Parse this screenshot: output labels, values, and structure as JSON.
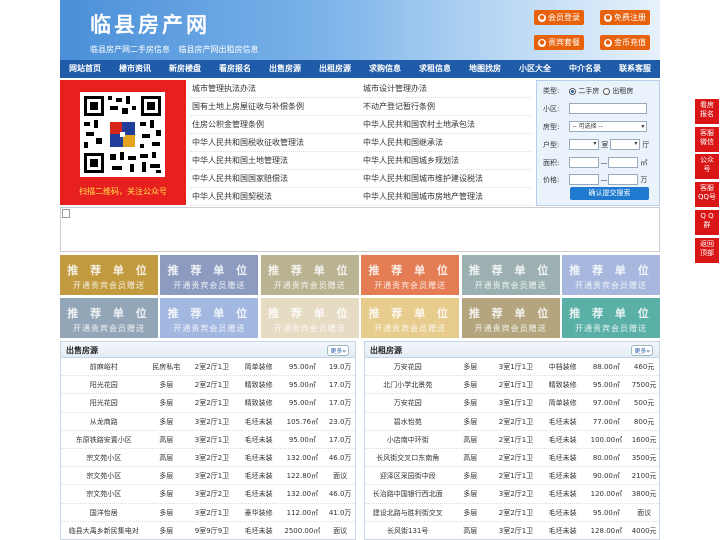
{
  "header": {
    "title": "临县房产网",
    "subtitle": "临县房产网二手房信息  临县房产网出租房信息",
    "buttons": [
      "会员登录",
      "免费注册",
      "贵宾套餐",
      "金币充值"
    ]
  },
  "nav": [
    "网站首页",
    "楼市资讯",
    "新房楼盘",
    "看房报名",
    "出售房源",
    "出租房源",
    "求购信息",
    "求租信息",
    "地图找房",
    "小区大全",
    "中介名录",
    "联系客服"
  ],
  "qr_caption": "扫描二维码，关注公众号",
  "links": [
    [
      "城市管理执法办法",
      "城市设计管理办法"
    ],
    [
      "国有土地上房屋征收与补偿条例",
      "不动产登记暂行条例"
    ],
    [
      "住房公积金管理条例",
      "中华人民共和国农村土地承包法"
    ],
    [
      "中华人民共和国税收征收管理法",
      "中华人民共和国继承法"
    ],
    [
      "中华人民共和国土地管理法",
      "中华人民共和国城乡规划法"
    ],
    [
      "中华人民共和国国家赔偿法",
      "中华人民共和国城市维护建设税法"
    ],
    [
      "中华人民共和国契税法",
      "中华人民共和国城市房地产管理法"
    ]
  ],
  "search": {
    "type_label": "类型:",
    "type_opt1": "二手房",
    "type_opt2": "出租房",
    "community_label": "小区:",
    "housetype_label": "房型:",
    "housetype_value": "-- 可选择 --",
    "layout_label": "户型:",
    "room": "室",
    "hall": "厅",
    "area_label": "面积:",
    "area_unit": "㎡",
    "price_label": "价格:",
    "price_unit": "万",
    "range_sep": "—",
    "submit": "确认提交搜索"
  },
  "tile": {
    "line1": "推 荐 单 位",
    "line2": "开通贵宾会员赠送"
  },
  "tile_colors": [
    "#c29a3f",
    "#8d9bc1",
    "#b9b391",
    "#e57d54",
    "#9cb0b2",
    "#a7b7dd",
    "#93a6b8",
    "#a3b8e0",
    "#e6dcc3",
    "#e7cc8d",
    "#b4a57f",
    "#5ab0a7"
  ],
  "sale": {
    "title": "出售房源",
    "more": "更多»",
    "rows": [
      [
        "前麻峪村",
        "民房私宅",
        "2室2厅1卫",
        "简单装修",
        "95.00㎡",
        "19.0万"
      ],
      [
        "阳光花园",
        "多层",
        "2室2厅1卫",
        "精致装修",
        "95.00㎡",
        "17.0万"
      ],
      [
        "阳光花园",
        "多层",
        "2室2厅1卫",
        "精致装修",
        "95.00㎡",
        "17.0万"
      ],
      [
        "从龙商路",
        "多层",
        "3室2厅1卫",
        "毛坯未装",
        "105.76㎡",
        "23.0万"
      ],
      [
        "东原铁路安置小区",
        "高层",
        "3室2厅1卫",
        "毛坯未装",
        "95.00㎡",
        "17.0万"
      ],
      [
        "宗文苑小区",
        "高层",
        "3室2厅2卫",
        "毛坯未装",
        "132.00㎡",
        "46.0万"
      ],
      [
        "宗文苑小区",
        "多层",
        "3室2厅1卫",
        "毛坯未装",
        "122.80㎡",
        "面议"
      ],
      [
        "宗文苑小区",
        "多层",
        "3室2厅2卫",
        "毛坯未装",
        "132.00㎡",
        "46.0万"
      ],
      [
        "国洋怡居",
        "多层",
        "3室2厅1卫",
        "豪华装修",
        "112.00㎡",
        "41.0万"
      ],
      [
        "临县大禹乡新民集电对",
        "多层",
        "9室9厅9卫",
        "毛坯未装",
        "2500.00㎡",
        "面议"
      ]
    ]
  },
  "rent": {
    "title": "出租房源",
    "more": "更多»",
    "rows": [
      [
        "万安花园",
        "多层",
        "3室1厅1卫",
        "中档装修",
        "88.00㎡",
        "460元"
      ],
      [
        "北门小学北景苑",
        "多层",
        "2室1厅1卫",
        "精致装修",
        "95.00㎡",
        "7500元"
      ],
      [
        "万安花园",
        "多层",
        "3室1厅1卫",
        "简单装修",
        "97.00㎡",
        "500元"
      ],
      [
        "碧水怡苑",
        "多层",
        "2室2厅1卫",
        "毛坯未装",
        "77.00㎡",
        "800元"
      ],
      [
        "小店南中环街",
        "高层",
        "2室1厅1卫",
        "毛坯未装",
        "100.00㎡",
        "1600元"
      ],
      [
        "长风街交叉口东南角",
        "高层",
        "2室2厅1卫",
        "毛坯未装",
        "80.00㎡",
        "3500元"
      ],
      [
        "迎泽区采园街中段",
        "多层",
        "2室1厅1卫",
        "毛坯未装",
        "90.00㎡",
        "2100元"
      ],
      [
        "长治路中国银行西北面",
        "多层",
        "3室2厅2卫",
        "毛坯未装",
        "120.00㎡",
        "3800元"
      ],
      [
        "建设北路与胜利街交叉",
        "多层",
        "2室2厅1卫",
        "毛坯未装",
        "95.00㎡",
        "面议"
      ],
      [
        "长风街131号",
        "高层",
        "3室2厅1卫",
        "毛坯未装",
        "128.00㎡",
        "4000元"
      ]
    ]
  },
  "side": [
    [
      "看房",
      "报名"
    ],
    [
      "客服",
      "微信"
    ],
    [
      "公众",
      "号"
    ],
    [
      "客服",
      "QQ号"
    ],
    [
      "Q Q",
      "群"
    ],
    [
      "返回",
      "顶部"
    ]
  ]
}
